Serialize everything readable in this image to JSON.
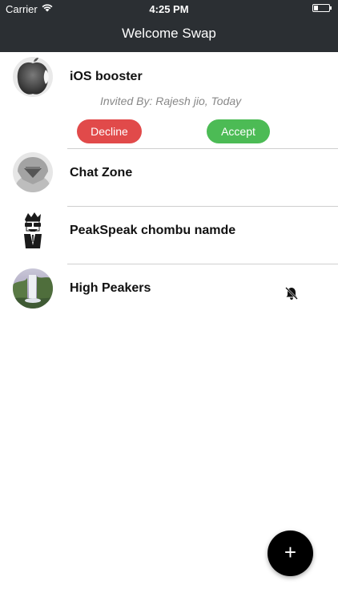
{
  "status_bar": {
    "carrier": "Carrier",
    "time": "4:25 PM",
    "battery_level": 0.3
  },
  "nav": {
    "title": "Welcome Swap"
  },
  "groups": [
    {
      "name": "iOS booster",
      "invited_text": "Invited By: Rajesh jio, Today",
      "decline_label": "Decline",
      "accept_label": "Accept",
      "avatar_icon": "apple-logo-icon"
    },
    {
      "name": "Chat Zone",
      "avatar_icon": "default-group-avatar-icon"
    },
    {
      "name": "PeakSpeak chombu namde",
      "avatar_icon": "hipster-avatar-icon"
    },
    {
      "name": "High Peakers",
      "avatar_icon": "waterfall-photo-avatar",
      "muted": true,
      "muted_icon": "bell-slash-icon"
    }
  ],
  "fab": {
    "label": "+",
    "icon": "plus-icon"
  },
  "colors": {
    "nav_bg": "#2b2f33",
    "decline": "#e14a4a",
    "accept": "#4cbb55",
    "fab": "#000000"
  }
}
